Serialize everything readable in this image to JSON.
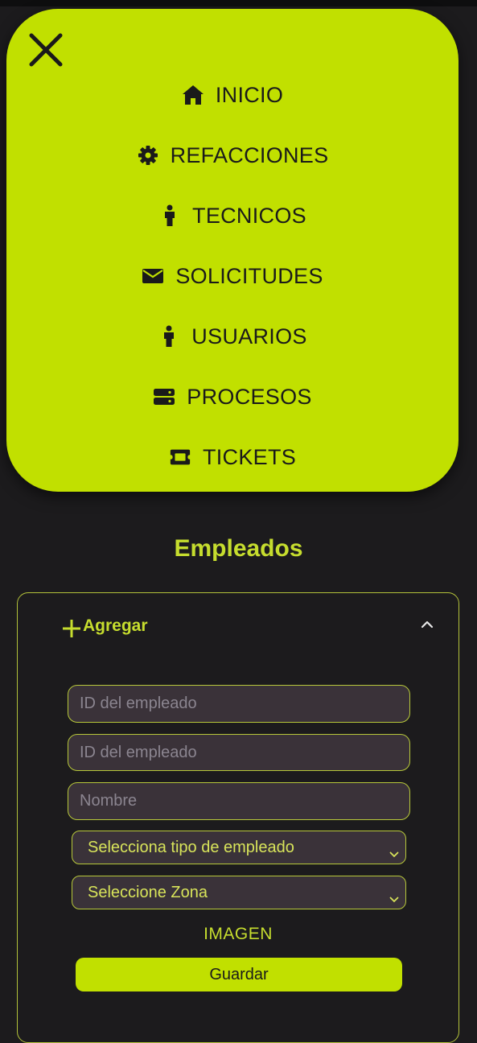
{
  "menu": {
    "items": [
      {
        "label": "INICIO",
        "icon": "home-icon"
      },
      {
        "label": "REFACCIONES",
        "icon": "gear-icon"
      },
      {
        "label": "TECNICOS",
        "icon": "person-icon"
      },
      {
        "label": "SOLICITUDES",
        "icon": "envelope-icon"
      },
      {
        "label": "USUARIOS",
        "icon": "person-icon"
      },
      {
        "label": "PROCESOS",
        "icon": "server-icon"
      },
      {
        "label": "TICKETS",
        "icon": "ticket-icon"
      }
    ]
  },
  "page": {
    "title": "Empleados"
  },
  "form": {
    "toggle_label": "Agregar",
    "inputs": [
      {
        "placeholder": "ID del empleado"
      },
      {
        "placeholder": "ID del empleado"
      },
      {
        "placeholder": "Nombre"
      }
    ],
    "selects": [
      {
        "value": "Selecciona tipo de empleado"
      },
      {
        "value": "Seleccione Zona"
      }
    ],
    "image_label": "IMAGEN",
    "save_label": "Guardar"
  },
  "colors": {
    "accent": "#c1e000",
    "background": "#1c1b1d",
    "field_bg": "#3a3239"
  }
}
